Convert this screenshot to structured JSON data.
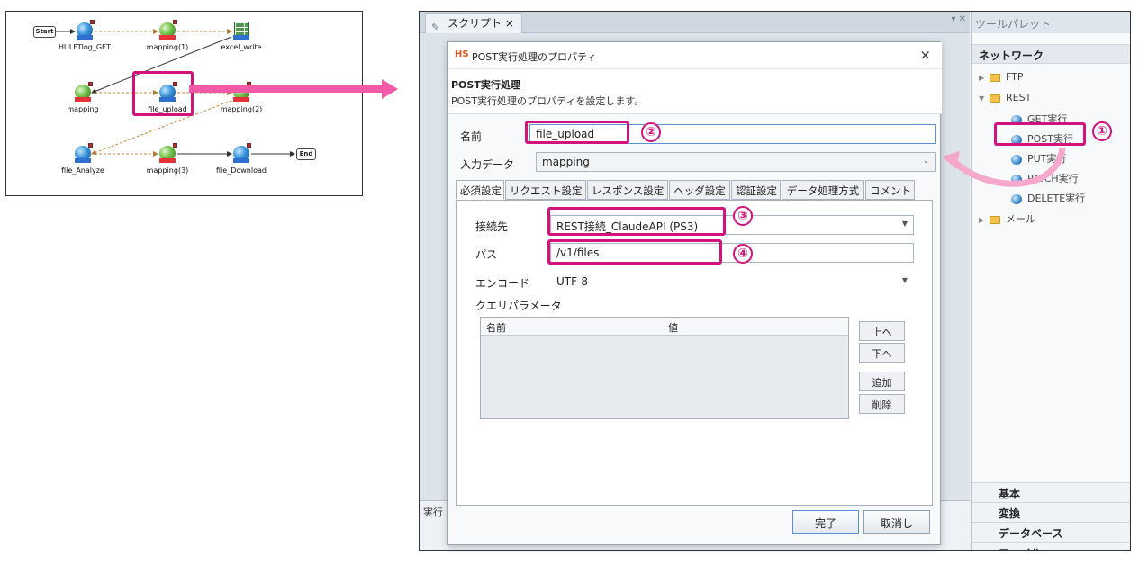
{
  "flow": {
    "nodes": {
      "start": "Start",
      "hulftlog_get": "HULFTlog_GET",
      "mapping1": "mapping(1)",
      "excel_write": "excel_write",
      "mapping": "mapping",
      "file_upload": "file_upload",
      "mapping2": "mapping(2)",
      "file_analyze": "file_Analyze",
      "mapping3": "mapping(3)",
      "file_download": "file_Download",
      "end": "End"
    }
  },
  "ide": {
    "editor_tab": "スクリプト ×",
    "exec_label": "実行",
    "palette": {
      "title": "ツールパレット",
      "section": "ネットワーク",
      "items": [
        "FTP",
        "REST",
        "GET実行",
        "POST実行",
        "PUT実行",
        "PATCH実行",
        "DELETE実行",
        "メール"
      ],
      "bottom": [
        "基本",
        "変換",
        "データベース",
        "ファイル"
      ]
    }
  },
  "dialog": {
    "logo": "HS",
    "title": "POST実行処理のプロパティ",
    "close": "×",
    "heading": "POST実行処理",
    "description": "POST実行処理のプロパティを設定します。",
    "name_label": "名前",
    "name_value": "file_upload",
    "input_label": "入力データ",
    "input_value": "mapping",
    "tabs": [
      "必須設定",
      "リクエスト設定",
      "レスポンス設定",
      "ヘッダ設定",
      "認証設定",
      "データ処理方式",
      "コメント"
    ],
    "connection_label": "接続先",
    "connection_value": "REST接続_ClaudeAPI (PS3)",
    "path_label": "パス",
    "path_value": "/v1/files",
    "encode_label": "エンコード",
    "encode_value": "UTF-8",
    "query_label": "クエリパラメータ",
    "query_columns": [
      "名前",
      "値"
    ],
    "side_buttons": [
      "上へ",
      "下へ",
      "追加",
      "削除"
    ],
    "ok": "完了",
    "cancel": "取消し"
  },
  "annotations": [
    "①",
    "②",
    "③",
    "④"
  ],
  "colors": {
    "highlight": "#d4127c",
    "arrow": "#f25aa8"
  }
}
